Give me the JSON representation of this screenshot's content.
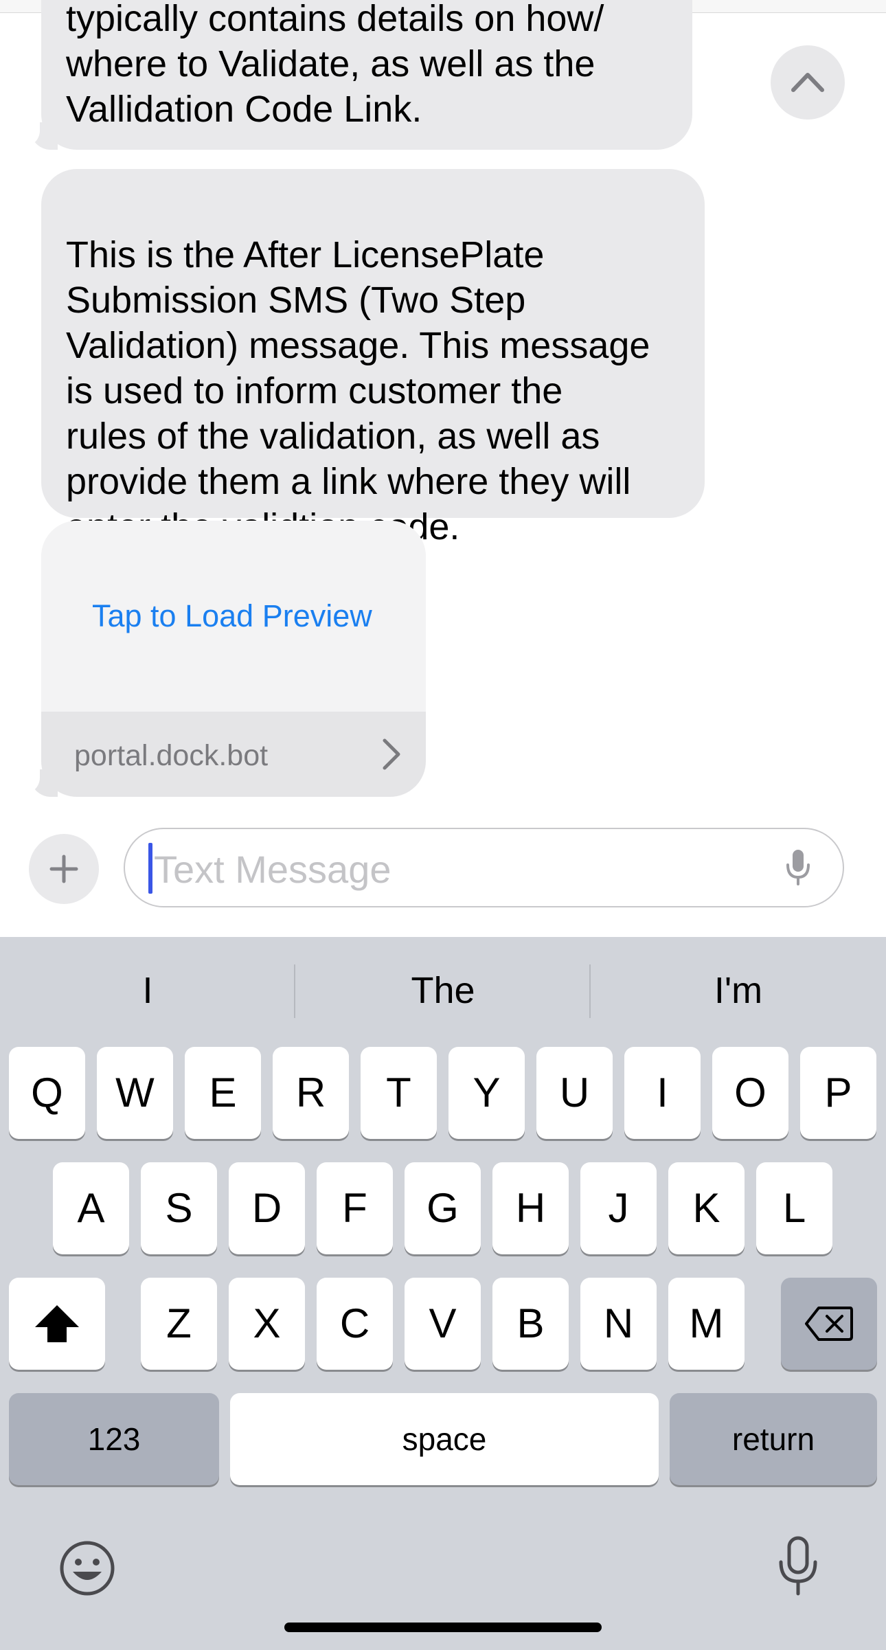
{
  "messages": [
    {
      "text": "typically contains details on how/\nwhere to Validate, as well as the\nVallidation Code Link."
    },
    {
      "text": "This is the After LicensePlate\nSubmission SMS (Two Step\nValidation) message. This message\nis used to inform customer the\nrules of the validation, as well as\nprovide them a link where they will\nenter the validtion code."
    }
  ],
  "link_preview": {
    "action_label": "Tap to Load Preview",
    "domain": "portal.dock.bot"
  },
  "composer": {
    "placeholder": "Text Message"
  },
  "keyboard": {
    "suggestions": [
      "I",
      "The",
      "I'm"
    ],
    "row1": [
      "Q",
      "W",
      "E",
      "R",
      "T",
      "Y",
      "U",
      "I",
      "O",
      "P"
    ],
    "row2": [
      "A",
      "S",
      "D",
      "F",
      "G",
      "H",
      "J",
      "K",
      "L"
    ],
    "row3": [
      "Z",
      "X",
      "C",
      "V",
      "B",
      "N",
      "M"
    ],
    "numbers_label": "123",
    "space_label": "space",
    "return_label": "return"
  },
  "colors": {
    "bubble": "#e9e9eb",
    "link": "#1a7ff0",
    "keyboard_bg": "#d1d4da",
    "caret": "#3a56e6"
  },
  "icons": [
    "chevron-up-icon",
    "chevron-right-icon",
    "plus-icon",
    "microphone-icon",
    "shift-icon",
    "delete-icon",
    "emoji-icon"
  ]
}
